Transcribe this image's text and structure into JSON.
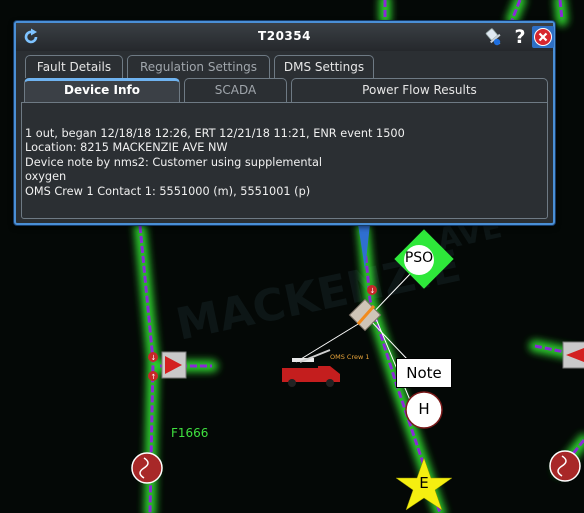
{
  "window": {
    "title": "T20354",
    "icons": [
      "refresh-icon",
      "pin-icon",
      "help-icon",
      "close-icon"
    ],
    "help_glyph": "?"
  },
  "tabs_row1": [
    {
      "label": "Fault Details",
      "state": "normal"
    },
    {
      "label": "Regulation Settings",
      "state": "dim"
    },
    {
      "label": "DMS Settings",
      "state": "normal"
    }
  ],
  "tabs_row2": [
    {
      "label": "Device Info",
      "state": "active"
    },
    {
      "label": "SCADA",
      "state": "dim"
    },
    {
      "label": "Power Flow Results",
      "state": "normal"
    }
  ],
  "device_info": {
    "lines": [
      "1 out, began 12/18/18 12:26, ERT 12/21/18 11:21, ENR event 1500",
      "Location: 8215 MACKENZIE AVE NW",
      "Device note by nms2: Customer using supplemental",
      "oxygen",
      "OMS Crew 1 Contact 1: 5551000 (m), 5551001 (p)"
    ]
  },
  "map": {
    "feeder_label": "F1666",
    "crew_label": "OMS Crew 1",
    "pso_label": "PSO",
    "note_label": "Note",
    "h_label": "H",
    "e_label": "E",
    "colors": {
      "background": "#040806",
      "feeder_glow": "#37ff37",
      "feeder_line": "#8a2bd8",
      "feeder_text": "#3fe03f",
      "crew_truck": "#c41e1e",
      "star": "#f5ef10",
      "pso_diamond": "#2ee83a",
      "dialog_border": "#4a8fd6"
    }
  }
}
